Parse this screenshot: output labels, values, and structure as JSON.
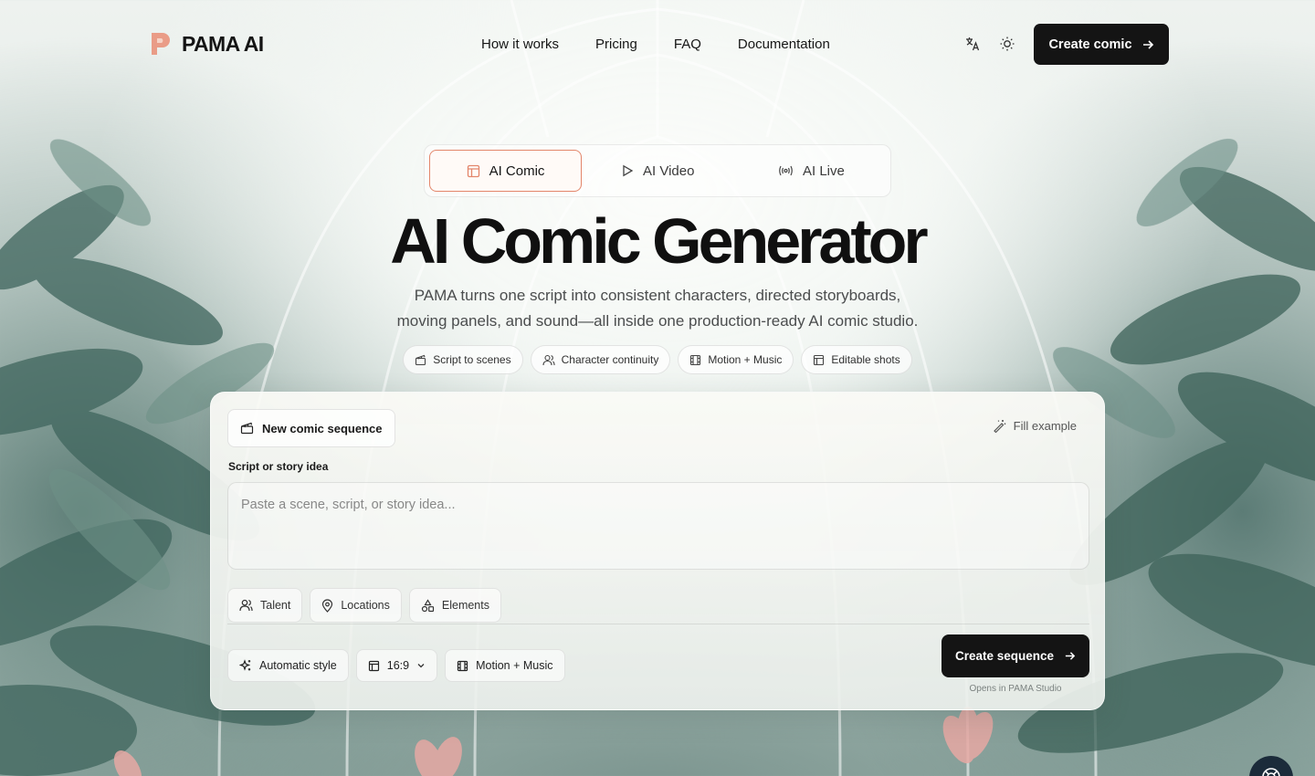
{
  "brand": {
    "name": "PAMA AI",
    "accent": "#e3866b"
  },
  "nav": {
    "links": [
      "How it works",
      "Pricing",
      "FAQ",
      "Documentation"
    ],
    "translate_icon": "translate-icon",
    "theme_icon": "sun-icon",
    "cta_label": "Create comic"
  },
  "tabs": [
    {
      "label": "AI Comic",
      "icon": "layout-icon",
      "active": true
    },
    {
      "label": "AI Video",
      "icon": "play-icon",
      "active": false
    },
    {
      "label": "AI Live",
      "icon": "broadcast-icon",
      "active": false
    }
  ],
  "hero": {
    "title": "AI Comic Generator",
    "subtitle_line1": "PAMA turns one script into consistent characters, directed storyboards,",
    "subtitle_line2": "moving panels, and sound—all inside one production-ready AI comic studio."
  },
  "features": [
    {
      "label": "Script to scenes",
      "icon": "clapper-icon"
    },
    {
      "label": "Character continuity",
      "icon": "users-icon"
    },
    {
      "label": "Motion + Music",
      "icon": "film-icon"
    },
    {
      "label": "Editable shots",
      "icon": "layout-icon"
    }
  ],
  "composer": {
    "sequence_button": "New comic sequence",
    "fill_example": "Fill example",
    "script_label": "Script or story idea",
    "script_placeholder": "Paste a scene, script, or story idea...",
    "script_value": "",
    "assets": [
      {
        "label": "Talent",
        "icon": "users-icon"
      },
      {
        "label": "Locations",
        "icon": "map-pin-icon"
      },
      {
        "label": "Elements",
        "icon": "shapes-icon"
      }
    ],
    "style_option": "Automatic style",
    "aspect_option": "16:9",
    "motion_option": "Motion + Music",
    "create_label": "Create sequence",
    "create_note": "Opens in PAMA Studio"
  }
}
